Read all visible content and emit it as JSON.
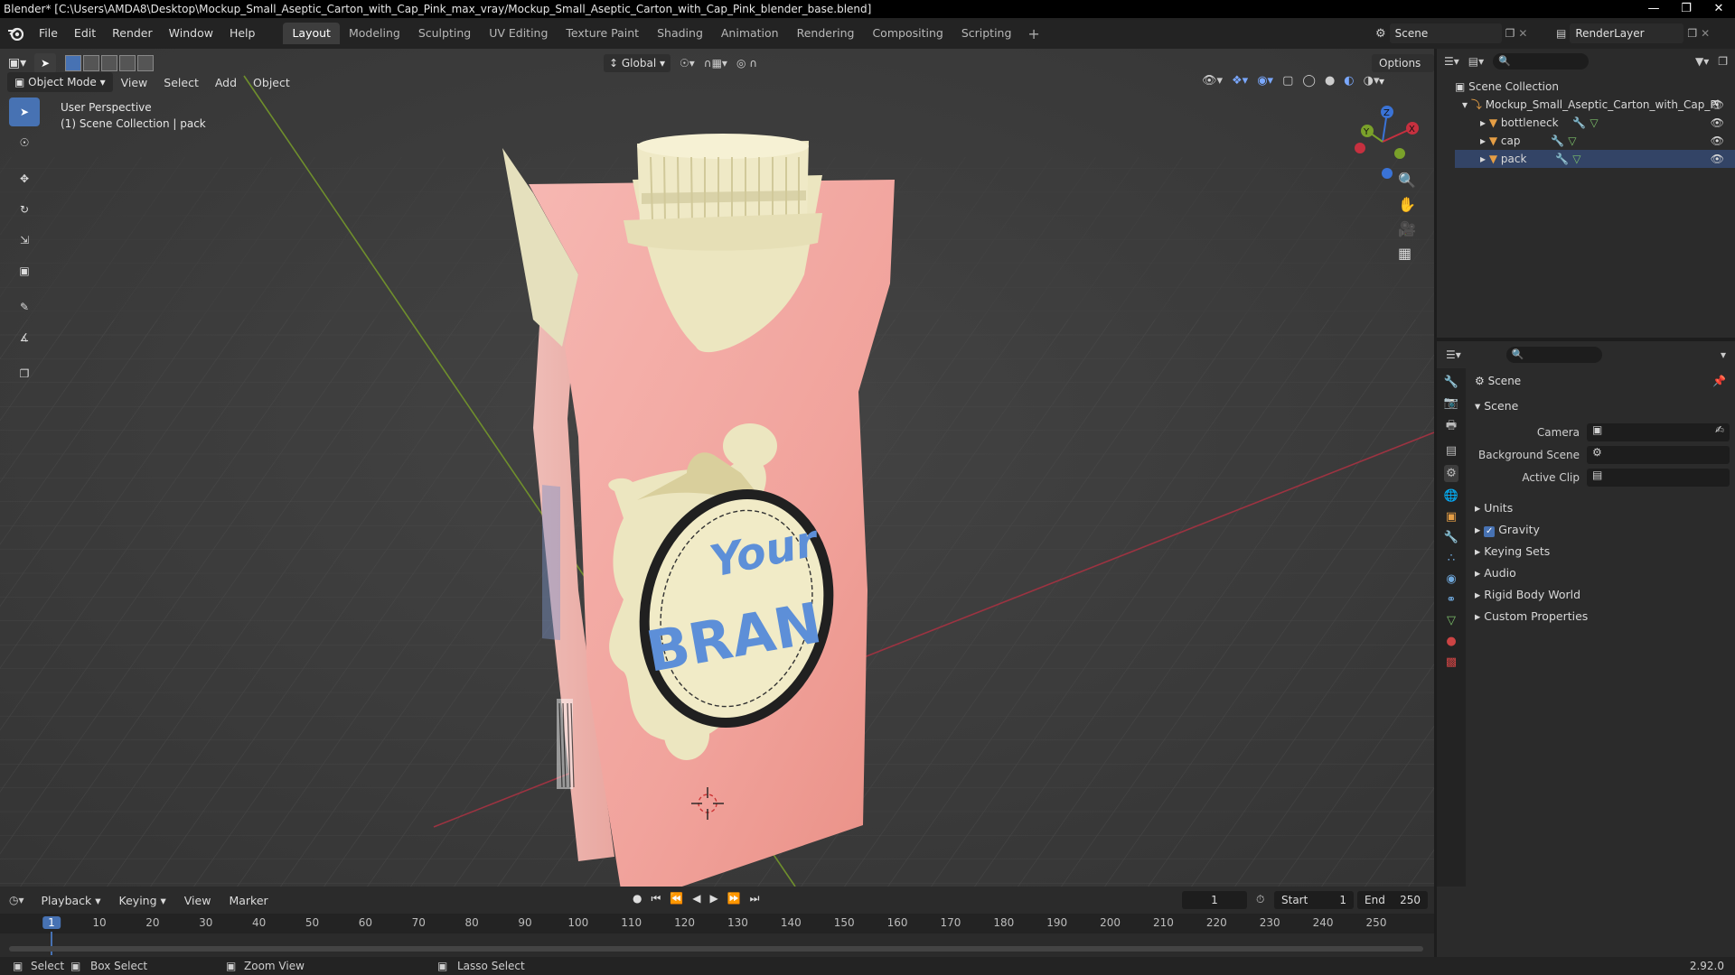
{
  "window": {
    "title": "Blender* [C:\\Users\\AMDA8\\Desktop\\Mockup_Small_Aseptic_Carton_with_Cap_Pink_max_vray/Mockup_Small_Aseptic_Carton_with_Cap_Pink_blender_base.blend]"
  },
  "menu": [
    "File",
    "Edit",
    "Render",
    "Window",
    "Help"
  ],
  "workspaces": [
    {
      "label": "Layout",
      "active": true
    },
    {
      "label": "Modeling"
    },
    {
      "label": "Sculpting"
    },
    {
      "label": "UV Editing"
    },
    {
      "label": "Texture Paint"
    },
    {
      "label": "Shading"
    },
    {
      "label": "Animation"
    },
    {
      "label": "Rendering"
    },
    {
      "label": "Compositing"
    },
    {
      "label": "Scripting"
    }
  ],
  "scene_name": "Scene",
  "render_layer": "RenderLayer",
  "viewport": {
    "mode": "Object Mode",
    "header_menus": [
      "View",
      "Select",
      "Add",
      "Object"
    ],
    "orientation": "Global",
    "options_label": "Options",
    "overlay_title": "User Perspective",
    "overlay_subtitle": "(1) Scene Collection | pack",
    "label_your": "Your",
    "label_brand": "BRAN",
    "gizmo": {
      "z": "Z",
      "y": "Y",
      "x": "X"
    }
  },
  "outliner": {
    "root": "Scene Collection",
    "collection": "Mockup_Small_Aseptic_Carton_with_Cap_Pi",
    "objects": [
      "bottleneck",
      "cap",
      "pack"
    ]
  },
  "properties": {
    "header": "Scene",
    "panel": "Scene",
    "fields": [
      {
        "label": "Camera"
      },
      {
        "label": "Background Scene"
      },
      {
        "label": "Active Clip"
      }
    ],
    "sections": [
      "Units",
      "Gravity",
      "Keying Sets",
      "Audio",
      "Rigid Body World",
      "Custom Properties"
    ],
    "gravity_enabled": true
  },
  "timeline": {
    "menus": [
      "Playback",
      "Keying",
      "View",
      "Marker"
    ],
    "current_frame": "1",
    "start_label": "Start",
    "start": "1",
    "end_label": "End",
    "end": "250",
    "ticks": [
      "1",
      "10",
      "20",
      "30",
      "40",
      "50",
      "60",
      "70",
      "80",
      "90",
      "100",
      "110",
      "120",
      "130",
      "140",
      "150",
      "160",
      "170",
      "180",
      "190",
      "200",
      "210",
      "220",
      "230",
      "240",
      "250"
    ]
  },
  "status": {
    "select": "Select",
    "box_select": "Box Select",
    "zoom_view": "Zoom View",
    "lasso_select": "Lasso Select",
    "version": "2.92.0"
  },
  "colors": {
    "accent": "#4772b3",
    "carton_pink": "#f2a5a0",
    "cap_cream": "#ece6c0",
    "x_axis": "#c6303f",
    "y_axis": "#7aa12a",
    "z_axis": "#3a73d6"
  }
}
